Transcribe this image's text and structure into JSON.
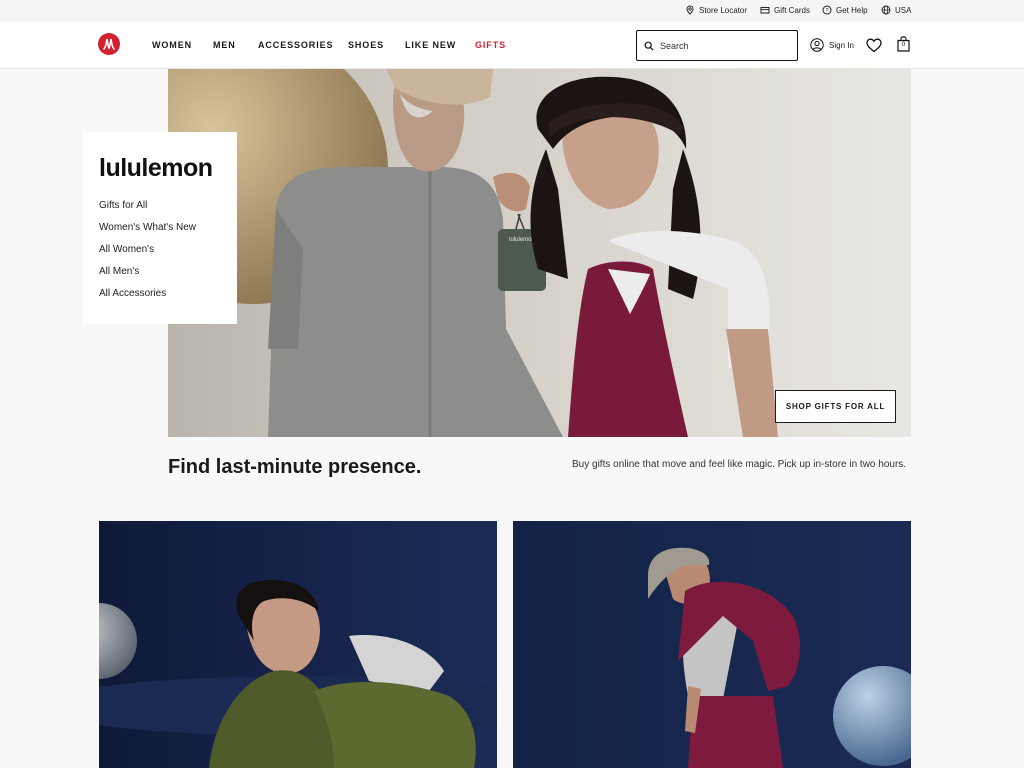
{
  "utility": {
    "store_locator": "Store Locator",
    "gift_cards": "Gift Cards",
    "get_help": "Get Help",
    "region": "USA"
  },
  "nav": {
    "women": "WOMEN",
    "men": "MEN",
    "accessories": "ACCESSORIES",
    "shoes": "SHOES",
    "like_new": "LIKE NEW",
    "gifts": "GIFTS"
  },
  "search": {
    "placeholder": "Search",
    "value": ""
  },
  "account": {
    "sign_in": "Sign In",
    "bag_count": "0"
  },
  "hero": {
    "brand": "lululemon",
    "links": [
      "Gifts for All",
      "Women's What's New",
      "All Women's",
      "All Men's",
      "All Accessories"
    ],
    "cta": "SHOP GIFTS FOR ALL",
    "bag_label": "lululemon"
  },
  "promo": {
    "headline": "Find last-minute presence.",
    "subline": "Buy gifts online that move and feel like magic. Pick up in-store in two hours."
  },
  "colors": {
    "brand_red": "#d22030",
    "hero_bg": "#d3cfc7",
    "tile_bg": "#15234a",
    "burgundy": "#7a1a3a"
  }
}
